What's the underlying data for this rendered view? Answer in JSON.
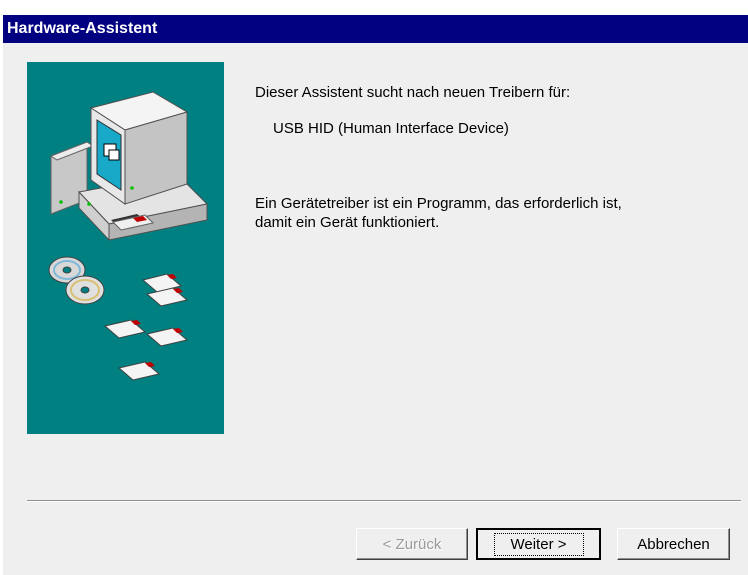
{
  "window": {
    "title": "Hardware-Assistent"
  },
  "content": {
    "intro": "Dieser Assistent sucht nach neuen Treibern für:",
    "device_name": "USB HID (Human Interface Device)",
    "description_line1": "Ein Gerätetreiber ist ein Programm, das erforderlich ist,",
    "description_line2": "damit ein Gerät funktioniert."
  },
  "buttons": {
    "back": {
      "label": "< Zurück",
      "enabled": false
    },
    "next": {
      "label": "Weiter >",
      "default": true
    },
    "cancel": {
      "label": "Abbrechen"
    }
  },
  "colors": {
    "titlebar": "#000080",
    "illustration_bg": "#008080",
    "dialog_bg": "#efefef"
  }
}
